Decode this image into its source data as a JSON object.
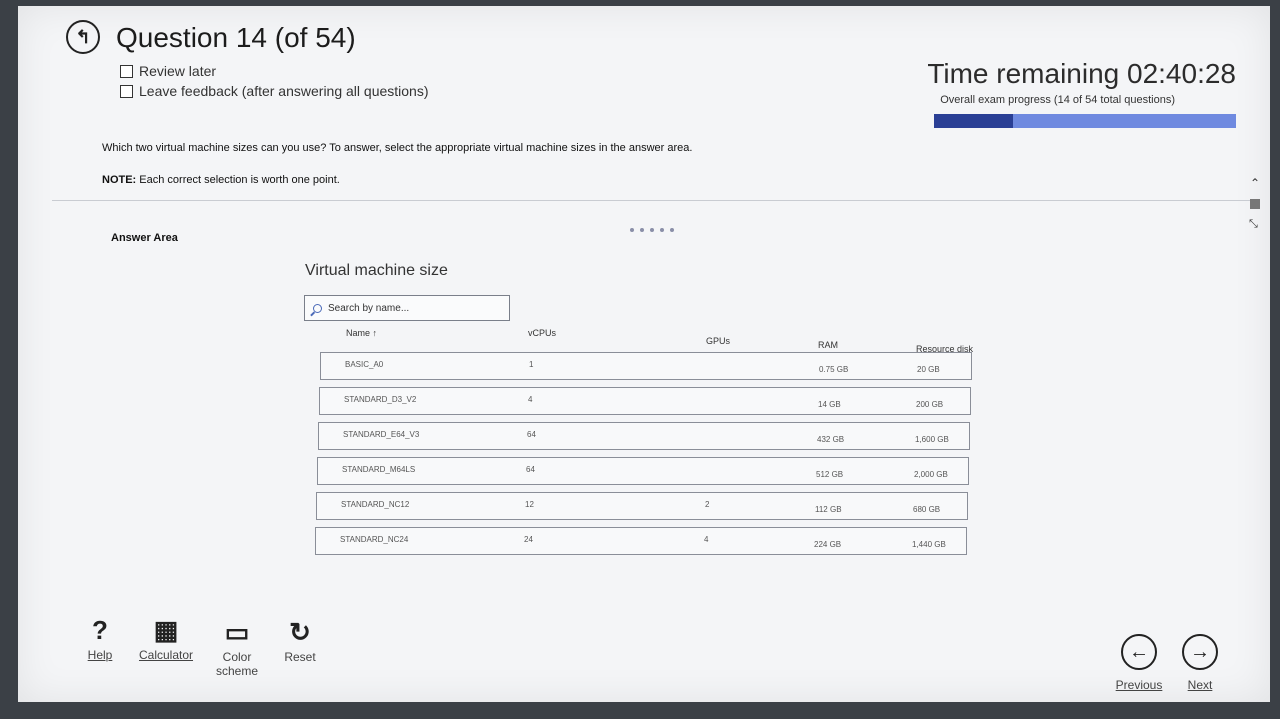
{
  "header": {
    "title": "Question 14 (of 54)",
    "review_later": "Review later",
    "leave_feedback": "Leave feedback (after answering all questions)",
    "time_remaining": "Time remaining 02:40:28",
    "progress_text": "Overall exam progress (14 of 54 total questions)",
    "progress_fraction": 0.26
  },
  "question": {
    "text": "Which two virtual machine sizes can you use? To answer, select the appropriate virtual machine sizes in the answer area.",
    "note_label": "NOTE:",
    "note_text": " Each correct selection is worth one point.",
    "answer_area_label": "Answer Area"
  },
  "vm_table": {
    "title": "Virtual machine size",
    "search_placeholder": "Search by name...",
    "columns": [
      "Name ↑",
      "vCPUs",
      "GPUs",
      "RAM",
      "Resource disk"
    ],
    "rows": [
      {
        "name": "BASIC_A0",
        "vcpus": "1",
        "gpus": "",
        "ram": "0.75 GB",
        "disk": "20 GB"
      },
      {
        "name": "STANDARD_D3_V2",
        "vcpus": "4",
        "gpus": "",
        "ram": "14 GB",
        "disk": "200 GB"
      },
      {
        "name": "STANDARD_E64_V3",
        "vcpus": "64",
        "gpus": "",
        "ram": "432 GB",
        "disk": "1,600 GB"
      },
      {
        "name": "STANDARD_M64LS",
        "vcpus": "64",
        "gpus": "",
        "ram": "512 GB",
        "disk": "2,000 GB"
      },
      {
        "name": "STANDARD_NC12",
        "vcpus": "12",
        "gpus": "2",
        "ram": "112 GB",
        "disk": "680 GB"
      },
      {
        "name": "STANDARD_NC24",
        "vcpus": "24",
        "gpus": "4",
        "ram": "224 GB",
        "disk": "1,440 GB"
      }
    ]
  },
  "toolbar": {
    "help": "Help",
    "calculator": "Calculator",
    "color_scheme_1": "Color",
    "color_scheme_2": "scheme",
    "reset": "Reset"
  },
  "nav": {
    "previous": "Previous",
    "next": "Next"
  },
  "icons": {
    "back": "back-arrow-icon",
    "help": "question-mark-icon",
    "calculator": "calculator-icon",
    "color_scheme": "monitor-icon",
    "reset": "reset-icon",
    "previous": "arrow-left-icon",
    "next": "arrow-right-icon",
    "search": "search-icon"
  },
  "colors": {
    "progress_fill": "#2a3f95",
    "progress_track": "#6f8ae0"
  }
}
